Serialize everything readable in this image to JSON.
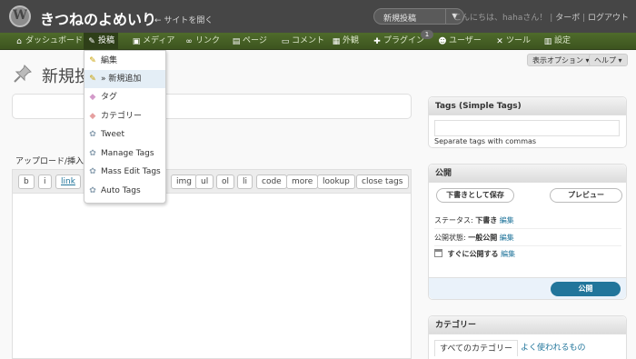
{
  "header": {
    "site_title": "きつねのよめいり",
    "visit_site": "← サイトを開く",
    "favorite_action": "新規投稿",
    "greeting": "こんにちは、hahaさん！",
    "username": "ターボ",
    "logout": "ログアウト"
  },
  "menu": [
    {
      "label": "ダッシュボード",
      "icon": "home-icon"
    },
    {
      "label": "投稿",
      "icon": "pin-icon"
    },
    {
      "label": "メディア",
      "icon": "media-icon"
    },
    {
      "label": "リンク",
      "icon": "link-icon"
    },
    {
      "label": "ページ",
      "icon": "pages-icon"
    },
    {
      "label": "コメント",
      "icon": "comment-icon"
    },
    {
      "label": "外観",
      "icon": "appearance-icon"
    },
    {
      "label": "プラグイン",
      "icon": "plugin-icon"
    },
    {
      "label": "ユーザー",
      "icon": "users-icon"
    },
    {
      "label": "ツール",
      "icon": "tools-icon"
    },
    {
      "label": "設定",
      "icon": "settings-icon"
    }
  ],
  "plugin_update_count": "1",
  "screen_options": "表示オプション ▾",
  "help": "ヘルプ ▾",
  "page_title": "新規投",
  "upload_label": "アップロード/挿入",
  "post_submenu": [
    {
      "label": "編集",
      "icon": "pencil-icon"
    },
    {
      "label": "» 新規追加",
      "icon": "pencil-icon"
    },
    {
      "label": "タグ",
      "icon": "tag-icon"
    },
    {
      "label": "カテゴリー",
      "icon": "tag-icon"
    },
    {
      "label": "Tweet",
      "icon": "gear-icon"
    },
    {
      "label": "Manage Tags",
      "icon": "gear-icon"
    },
    {
      "label": "Mass Edit Tags",
      "icon": "gear-icon"
    },
    {
      "label": "Auto Tags",
      "icon": "gear-icon"
    }
  ],
  "quicktags": [
    "b",
    "i",
    "link",
    "img",
    "ul",
    "ol",
    "li",
    "code",
    "more",
    "lookup",
    "close tags"
  ],
  "tags_box": {
    "title": "Tags (Simple Tags)",
    "hint": "Separate tags with commas"
  },
  "publish_box": {
    "title": "公開",
    "save_draft": "下書きとして保存",
    "preview": "プレビュー",
    "status_label": "ステータス:",
    "status_value": "下書き",
    "visibility_label": "公開状態:",
    "visibility_value": "一般公開",
    "schedule_label": "すぐに公開する",
    "edit": "編集",
    "publish": "公開"
  },
  "category_box": {
    "title": "カテゴリー",
    "tab_all": "すべてのカテゴリー",
    "tab_popular": "よく使われるもの"
  }
}
